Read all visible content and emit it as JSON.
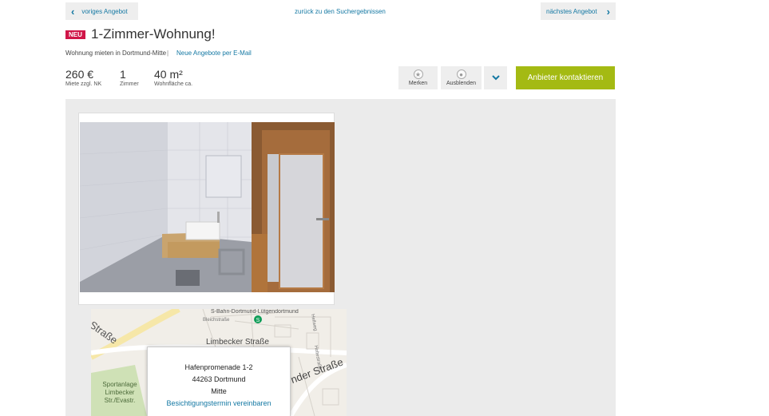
{
  "nav": {
    "prev_label": "voriges Angebot",
    "back_label": "zurück zu den Suchergebnissen",
    "next_label": "nächstes Angebot"
  },
  "listing": {
    "badge": "NEU",
    "title": "1-Zimmer-Wohnung!",
    "subtitle": "Wohnung mieten in Dortmund-Mitte",
    "separator": "|",
    "email_alert_link": "Neue Angebote per E-Mail"
  },
  "facts": [
    {
      "value": "260 €",
      "label": "Miete zzgl. NK"
    },
    {
      "value": "1",
      "label": "Zimmer"
    },
    {
      "value": "40 m²",
      "label": "Wohnfläche ca."
    }
  ],
  "actions": {
    "save_label": "Merken",
    "hide_label": "Ausblenden",
    "contact_label": "Anbieter kontaktieren"
  },
  "map": {
    "streets": {
      "station": "S-Bahn-Dortmund-Lütgendortmund",
      "limbecker": "Limbecker Straße",
      "strasse_left": "Straße",
      "strasse_right": "nder Straße",
      "bleichst": "Bleichstraße",
      "hellweg": "Hellweg",
      "hofstr": "Holtestraße"
    },
    "park_label": [
      "Sportanlage",
      "Limbecker",
      "Str./Evastr."
    ],
    "address_line1": "Hafenpromenade 1-2",
    "address_line2": "44263 Dortmund",
    "address_line3": "Mitte",
    "appointment_link": "Besichtigungstermin vereinbaren"
  },
  "colors": {
    "accent_link": "#1478a3",
    "badge": "#d01648",
    "contact_button": "#a4ba13",
    "gallery_bg": "#ebebeb"
  }
}
